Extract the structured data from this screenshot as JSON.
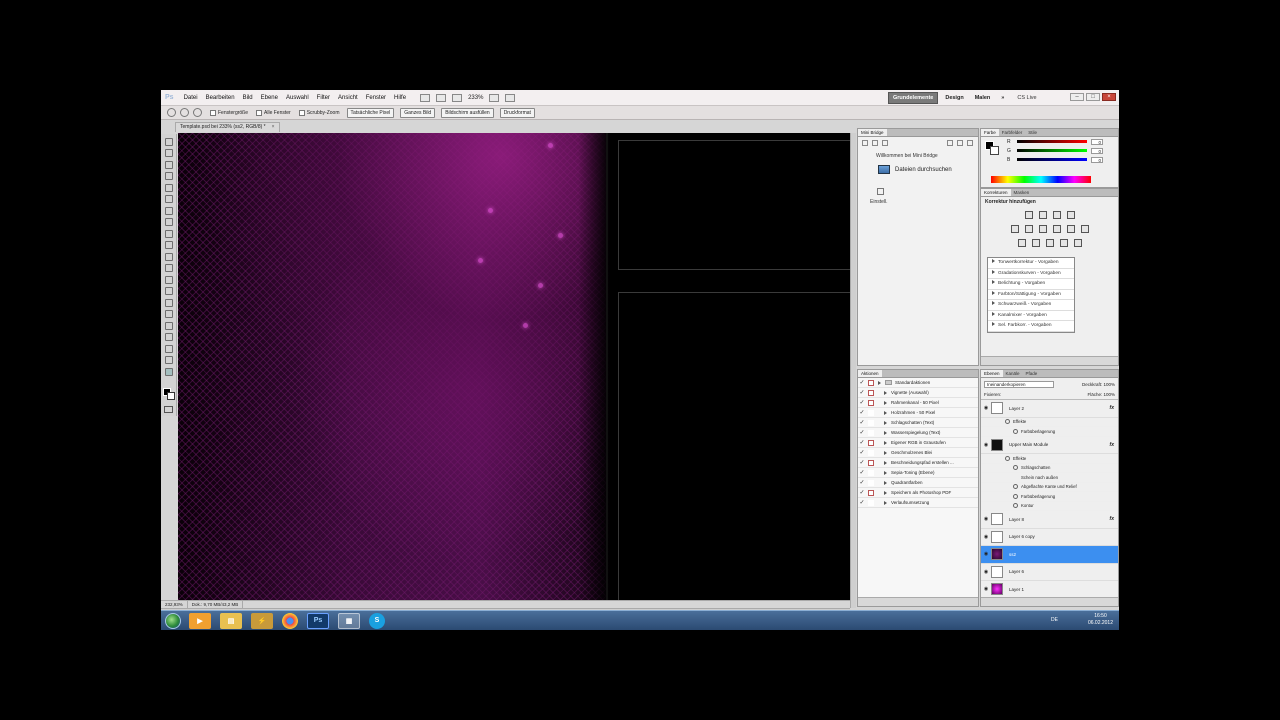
{
  "menubar": {
    "logo": "Ps",
    "items": [
      "Datei",
      "Bearbeiten",
      "Bild",
      "Ebene",
      "Auswahl",
      "Filter",
      "Ansicht",
      "Fenster",
      "Hilfe"
    ],
    "zoom": "233%",
    "workspaces": [
      "Grundelemente",
      "Design",
      "Malen"
    ],
    "cslive": "CS Live"
  },
  "optbar": {
    "checks": [
      "Fenstergröße",
      "Alle Fenster",
      "Scrubby-Zoom"
    ],
    "buttons": [
      "Tatsächliche Pixel",
      "Ganzes Bild",
      "Bildschirm ausfüllen",
      "Druckformat"
    ]
  },
  "document": {
    "tab": "Template.psd bei 233% (ss2, RGB/8) *",
    "close": "×"
  },
  "status": {
    "zoom": "232,93%",
    "doc": "Dok.: 9,70 MB/43,2 MB"
  },
  "minibridge": {
    "tab": "Mini Bridge",
    "welcome": "Willkommen bei Mini Bridge",
    "browse": "Dateien durchsuchen",
    "settings": "Einstell."
  },
  "actions": {
    "tab": "Aktionen",
    "set": "Standardaktionen",
    "items": [
      "Vignette (Auswahl)",
      "Rahmenkanal - 50 Pixel",
      "Holzrahmen - 50 Pixel",
      "Schlagschatten (Text)",
      "Wasserspiegelung (Text)",
      "Eigener RGB in Graustufen",
      "Geschmolzenes Blei",
      "Beschneidungspfad erstellen ...",
      "Sepia-Toning (Ebene)",
      "Quadrantfarben",
      "Speichern als Photoshop PDF",
      "Verlaufsumsetzung"
    ]
  },
  "color": {
    "tabs": [
      "Farbe",
      "Farbfelder",
      "Stile"
    ],
    "labels": [
      "R",
      "G",
      "B"
    ],
    "values": [
      "0",
      "0",
      "0"
    ]
  },
  "adjustments": {
    "tabs": [
      "Korrekturen",
      "Masken"
    ],
    "title": "Korrektur hinzufügen",
    "presets": [
      "Tonwertkorrektur - Vorgaben",
      "Gradationskurven - Vorgaben",
      "Belichtung - Vorgaben",
      "Farbton/Sättigung - Vorgaben",
      "Schwarzweiß - Vorgaben",
      "Kanalmixer - Vorgaben",
      "Sel. Farbkorr. - Vorgaben"
    ]
  },
  "layers": {
    "tabs": [
      "Ebenen",
      "Kanäle",
      "Pfade"
    ],
    "blend": "Ineinanderkopieren",
    "opacity_label": "Deckkraft:",
    "opacity": "100%",
    "lock_label": "Fixieren:",
    "fill_label": "Fläche:",
    "fill": "100%",
    "layer2": "Layer 2",
    "effekte": "Effekte",
    "farbueberlagerung": "Farbüberlagerung",
    "upper": "Upper Main Module",
    "schlagschatten": "Schlagschatten",
    "schein": "Schein nach außen",
    "abgeflacht": "Abgeflachte Kante und Relief",
    "kontur": "Kontur",
    "layer8": "Layer 8",
    "layer6copy": "Layer 6 copy",
    "ss2": "ss2",
    "layer6": "Layer 6",
    "layer1": "Layer 1",
    "fx": "fx"
  },
  "taskbar": {
    "lang": "DE",
    "time": "16:50",
    "date": "06.02.2012"
  }
}
